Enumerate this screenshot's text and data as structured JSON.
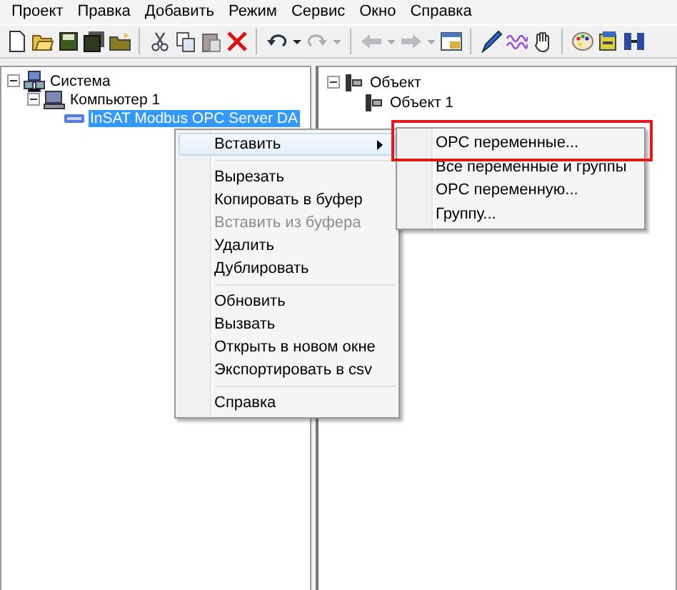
{
  "menu_bar": [
    "Проект",
    "Правка",
    "Добавить",
    "Режим",
    "Сервис",
    "Окно",
    "Справка"
  ],
  "toolbar": [
    {
      "kind": "new",
      "disabled": false
    },
    {
      "kind": "open",
      "disabled": false
    },
    {
      "kind": "save",
      "disabled": false
    },
    {
      "kind": "save-all",
      "disabled": false
    },
    {
      "kind": "folder",
      "disabled": false
    },
    {
      "kind": "sep"
    },
    {
      "kind": "cut",
      "disabled": false
    },
    {
      "kind": "copy",
      "disabled": false
    },
    {
      "kind": "paste",
      "disabled": false
    },
    {
      "kind": "delete",
      "disabled": false
    },
    {
      "kind": "sep"
    },
    {
      "kind": "undo",
      "disabled": false
    },
    {
      "kind": "drop",
      "disabled": false
    },
    {
      "kind": "redo",
      "disabled": true
    },
    {
      "kind": "drop",
      "disabled": true
    },
    {
      "kind": "sep"
    },
    {
      "kind": "back",
      "disabled": true
    },
    {
      "kind": "drop",
      "disabled": true
    },
    {
      "kind": "forward",
      "disabled": true
    },
    {
      "kind": "drop",
      "disabled": true
    },
    {
      "kind": "window",
      "disabled": false
    },
    {
      "kind": "sep"
    },
    {
      "kind": "pen",
      "disabled": false
    },
    {
      "kind": "wave",
      "disabled": false
    },
    {
      "kind": "hand",
      "disabled": false
    },
    {
      "kind": "sep"
    },
    {
      "kind": "palette",
      "disabled": false
    },
    {
      "kind": "device",
      "disabled": false
    },
    {
      "kind": "link",
      "disabled": false
    }
  ],
  "left_tree": [
    {
      "label": "Система",
      "kind": "system",
      "expanded": true,
      "selected": false,
      "children": [
        {
          "label": "Компьютер 1",
          "kind": "computer",
          "expanded": true,
          "selected": false,
          "children": [
            {
              "label": "InSAT Modbus OPC Server DA",
              "kind": "opc",
              "selected": true
            }
          ]
        }
      ]
    }
  ],
  "right_tree": [
    {
      "label": "Объект",
      "kind": "object",
      "expanded": true,
      "selected": false,
      "children": [
        {
          "label": "Объект 1",
          "kind": "object",
          "selected": false
        }
      ]
    }
  ],
  "context_menu": [
    [
      {
        "label": "Вставить",
        "selected": true,
        "disabled": false,
        "submenu": true
      }
    ],
    [
      {
        "label": "Вырезать",
        "selected": false,
        "disabled": false,
        "submenu": false
      },
      {
        "label": "Копировать в буфер",
        "selected": false,
        "disabled": false,
        "submenu": false
      },
      {
        "label": "Вставить из буфера",
        "selected": false,
        "disabled": true,
        "submenu": false
      },
      {
        "label": "Удалить",
        "selected": false,
        "disabled": false,
        "submenu": false
      },
      {
        "label": "Дублировать",
        "selected": false,
        "disabled": false,
        "submenu": false
      }
    ],
    [
      {
        "label": "Обновить",
        "selected": false,
        "disabled": false,
        "submenu": false
      },
      {
        "label": "Вызвать",
        "selected": false,
        "disabled": false,
        "submenu": false
      },
      {
        "label": "Открыть в новом окне",
        "selected": false,
        "disabled": false,
        "submenu": false
      },
      {
        "label": "Экспортировать в csv",
        "selected": false,
        "disabled": false,
        "submenu": false
      }
    ],
    [
      {
        "label": "Справка",
        "selected": false,
        "disabled": false,
        "submenu": false
      }
    ]
  ],
  "submenu": [
    {
      "label": "ОРС переменные...",
      "highlighted": true
    },
    {
      "label": "Все переменные и группы",
      "highlighted": false
    },
    {
      "label": "ОРС переменную...",
      "highlighted": false
    },
    {
      "label": "Группу...",
      "highlighted": false
    }
  ]
}
